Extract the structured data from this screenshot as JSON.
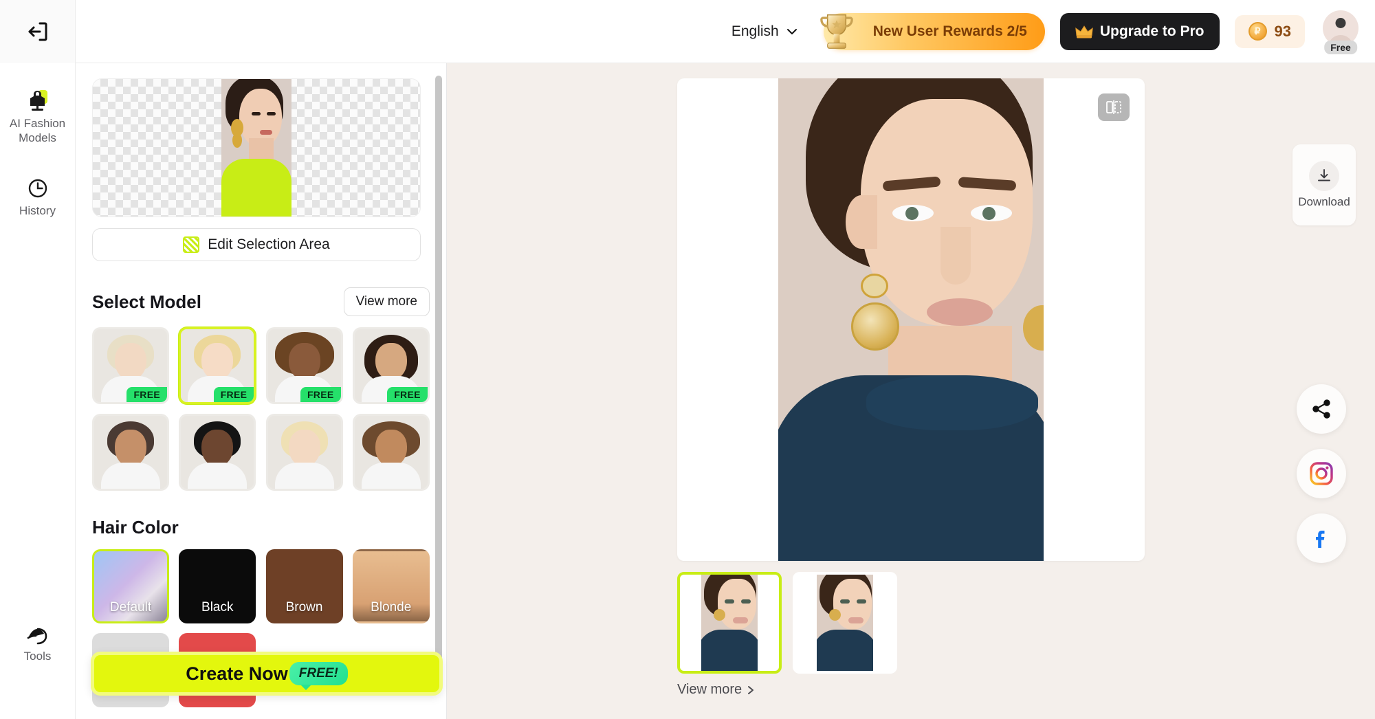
{
  "header": {
    "exit_icon": "exit-arrow-icon",
    "language": {
      "label": "English",
      "chevron": "chevron-down-icon"
    },
    "rewards": {
      "label": "New User Rewards 2/5",
      "icon": "trophy-icon"
    },
    "upgrade": {
      "label": "Upgrade to Pro",
      "icon": "crown-icon"
    },
    "credits": {
      "value": "93",
      "icon": "coin-icon"
    },
    "account": {
      "badge": "Free",
      "icon": "avatar-icon"
    }
  },
  "rail": {
    "items": [
      {
        "label": "AI Fashion Models",
        "icon": "mannequin-icon"
      },
      {
        "label": "History",
        "icon": "clock-icon"
      }
    ],
    "bottom": {
      "label": "Tools",
      "icon": "tools-icon"
    }
  },
  "panel": {
    "edit_selection": {
      "label": "Edit Selection Area",
      "icon": "hatch-selection-icon"
    },
    "select_model": {
      "title": "Select Model",
      "view_more": "View more",
      "models": [
        {
          "name": "Model 1",
          "badge": "FREE",
          "selected": false,
          "hair": "#e8dfc6",
          "skin": "#f2d9c3"
        },
        {
          "name": "Model 2",
          "badge": "FREE",
          "selected": true,
          "hair": "#ecd79a",
          "skin": "#f6dcc6"
        },
        {
          "name": "Model 3",
          "badge": "FREE",
          "selected": false,
          "hair": "#6b4423",
          "skin": "#8a5a3b"
        },
        {
          "name": "Model 4",
          "badge": "FREE",
          "selected": false,
          "hair": "#2e1d14",
          "skin": "#d6a880"
        },
        {
          "name": "Model 5",
          "badge": "",
          "selected": false,
          "hair": "#4a3a33",
          "skin": "#c59069"
        },
        {
          "name": "Model 6",
          "badge": "",
          "selected": false,
          "hair": "#141414",
          "skin": "#6d4630"
        },
        {
          "name": "Model 7",
          "badge": "",
          "selected": false,
          "hair": "#efe0b4",
          "skin": "#f3d9c2"
        },
        {
          "name": "Model 8",
          "badge": "",
          "selected": false,
          "hair": "#6d4a2e",
          "skin": "#c18a5e"
        }
      ]
    },
    "hair_color": {
      "title": "Hair Color",
      "swatches": [
        {
          "label": "Default",
          "color": "linear-gradient(135deg,#9ec6f5,#cdb7e8 45%,#e8e2ea 70%,#8a8396)",
          "selected": true
        },
        {
          "label": "Black",
          "color": "#0b0b0b",
          "selected": false
        },
        {
          "label": "Brown",
          "color": "#6e4026",
          "selected": false
        },
        {
          "label": "Blonde",
          "color": "linear-gradient(180deg,#e8bd90,#d8a173 75%,#8a6547)",
          "selected": false
        },
        {
          "label": "",
          "color": "#dcdcdc",
          "selected": false
        },
        {
          "label": "",
          "color": "#e34a4a",
          "selected": false
        }
      ]
    },
    "create": {
      "label": "Create Now",
      "badge": "FREE!"
    }
  },
  "canvas": {
    "compare_icon": "compare-split-icon",
    "download": {
      "label": "Download",
      "icon": "download-icon"
    },
    "thumbnails": [
      {
        "name": "Result 1",
        "selected": true
      },
      {
        "name": "Result 2",
        "selected": false
      }
    ],
    "view_more": "View more",
    "view_more_chevron": "chevron-right-icon",
    "social": [
      {
        "name": "share-icon"
      },
      {
        "name": "instagram-icon"
      },
      {
        "name": "facebook-icon"
      }
    ]
  },
  "colors": {
    "accent_lime": "#c8ed16",
    "brand_orange": "#ff9c17",
    "dark": "#1c1c1e",
    "free_green": "#25e06a",
    "canvas_bg": "#f4efeb"
  }
}
